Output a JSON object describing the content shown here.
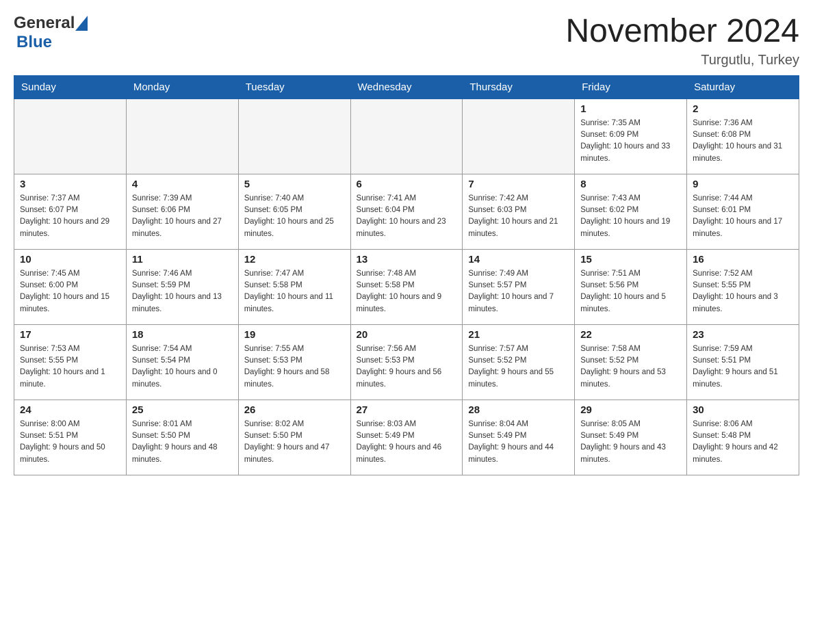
{
  "header": {
    "logo_general": "General",
    "logo_blue": "Blue",
    "month_title": "November 2024",
    "location": "Turgutlu, Turkey"
  },
  "weekdays": [
    "Sunday",
    "Monday",
    "Tuesday",
    "Wednesday",
    "Thursday",
    "Friday",
    "Saturday"
  ],
  "weeks": [
    [
      {
        "day": "",
        "empty": true
      },
      {
        "day": "",
        "empty": true
      },
      {
        "day": "",
        "empty": true
      },
      {
        "day": "",
        "empty": true
      },
      {
        "day": "",
        "empty": true
      },
      {
        "day": "1",
        "sunrise": "Sunrise: 7:35 AM",
        "sunset": "Sunset: 6:09 PM",
        "daylight": "Daylight: 10 hours and 33 minutes."
      },
      {
        "day": "2",
        "sunrise": "Sunrise: 7:36 AM",
        "sunset": "Sunset: 6:08 PM",
        "daylight": "Daylight: 10 hours and 31 minutes."
      }
    ],
    [
      {
        "day": "3",
        "sunrise": "Sunrise: 7:37 AM",
        "sunset": "Sunset: 6:07 PM",
        "daylight": "Daylight: 10 hours and 29 minutes."
      },
      {
        "day": "4",
        "sunrise": "Sunrise: 7:39 AM",
        "sunset": "Sunset: 6:06 PM",
        "daylight": "Daylight: 10 hours and 27 minutes."
      },
      {
        "day": "5",
        "sunrise": "Sunrise: 7:40 AM",
        "sunset": "Sunset: 6:05 PM",
        "daylight": "Daylight: 10 hours and 25 minutes."
      },
      {
        "day": "6",
        "sunrise": "Sunrise: 7:41 AM",
        "sunset": "Sunset: 6:04 PM",
        "daylight": "Daylight: 10 hours and 23 minutes."
      },
      {
        "day": "7",
        "sunrise": "Sunrise: 7:42 AM",
        "sunset": "Sunset: 6:03 PM",
        "daylight": "Daylight: 10 hours and 21 minutes."
      },
      {
        "day": "8",
        "sunrise": "Sunrise: 7:43 AM",
        "sunset": "Sunset: 6:02 PM",
        "daylight": "Daylight: 10 hours and 19 minutes."
      },
      {
        "day": "9",
        "sunrise": "Sunrise: 7:44 AM",
        "sunset": "Sunset: 6:01 PM",
        "daylight": "Daylight: 10 hours and 17 minutes."
      }
    ],
    [
      {
        "day": "10",
        "sunrise": "Sunrise: 7:45 AM",
        "sunset": "Sunset: 6:00 PM",
        "daylight": "Daylight: 10 hours and 15 minutes."
      },
      {
        "day": "11",
        "sunrise": "Sunrise: 7:46 AM",
        "sunset": "Sunset: 5:59 PM",
        "daylight": "Daylight: 10 hours and 13 minutes."
      },
      {
        "day": "12",
        "sunrise": "Sunrise: 7:47 AM",
        "sunset": "Sunset: 5:58 PM",
        "daylight": "Daylight: 10 hours and 11 minutes."
      },
      {
        "day": "13",
        "sunrise": "Sunrise: 7:48 AM",
        "sunset": "Sunset: 5:58 PM",
        "daylight": "Daylight: 10 hours and 9 minutes."
      },
      {
        "day": "14",
        "sunrise": "Sunrise: 7:49 AM",
        "sunset": "Sunset: 5:57 PM",
        "daylight": "Daylight: 10 hours and 7 minutes."
      },
      {
        "day": "15",
        "sunrise": "Sunrise: 7:51 AM",
        "sunset": "Sunset: 5:56 PM",
        "daylight": "Daylight: 10 hours and 5 minutes."
      },
      {
        "day": "16",
        "sunrise": "Sunrise: 7:52 AM",
        "sunset": "Sunset: 5:55 PM",
        "daylight": "Daylight: 10 hours and 3 minutes."
      }
    ],
    [
      {
        "day": "17",
        "sunrise": "Sunrise: 7:53 AM",
        "sunset": "Sunset: 5:55 PM",
        "daylight": "Daylight: 10 hours and 1 minute."
      },
      {
        "day": "18",
        "sunrise": "Sunrise: 7:54 AM",
        "sunset": "Sunset: 5:54 PM",
        "daylight": "Daylight: 10 hours and 0 minutes."
      },
      {
        "day": "19",
        "sunrise": "Sunrise: 7:55 AM",
        "sunset": "Sunset: 5:53 PM",
        "daylight": "Daylight: 9 hours and 58 minutes."
      },
      {
        "day": "20",
        "sunrise": "Sunrise: 7:56 AM",
        "sunset": "Sunset: 5:53 PM",
        "daylight": "Daylight: 9 hours and 56 minutes."
      },
      {
        "day": "21",
        "sunrise": "Sunrise: 7:57 AM",
        "sunset": "Sunset: 5:52 PM",
        "daylight": "Daylight: 9 hours and 55 minutes."
      },
      {
        "day": "22",
        "sunrise": "Sunrise: 7:58 AM",
        "sunset": "Sunset: 5:52 PM",
        "daylight": "Daylight: 9 hours and 53 minutes."
      },
      {
        "day": "23",
        "sunrise": "Sunrise: 7:59 AM",
        "sunset": "Sunset: 5:51 PM",
        "daylight": "Daylight: 9 hours and 51 minutes."
      }
    ],
    [
      {
        "day": "24",
        "sunrise": "Sunrise: 8:00 AM",
        "sunset": "Sunset: 5:51 PM",
        "daylight": "Daylight: 9 hours and 50 minutes."
      },
      {
        "day": "25",
        "sunrise": "Sunrise: 8:01 AM",
        "sunset": "Sunset: 5:50 PM",
        "daylight": "Daylight: 9 hours and 48 minutes."
      },
      {
        "day": "26",
        "sunrise": "Sunrise: 8:02 AM",
        "sunset": "Sunset: 5:50 PM",
        "daylight": "Daylight: 9 hours and 47 minutes."
      },
      {
        "day": "27",
        "sunrise": "Sunrise: 8:03 AM",
        "sunset": "Sunset: 5:49 PM",
        "daylight": "Daylight: 9 hours and 46 minutes."
      },
      {
        "day": "28",
        "sunrise": "Sunrise: 8:04 AM",
        "sunset": "Sunset: 5:49 PM",
        "daylight": "Daylight: 9 hours and 44 minutes."
      },
      {
        "day": "29",
        "sunrise": "Sunrise: 8:05 AM",
        "sunset": "Sunset: 5:49 PM",
        "daylight": "Daylight: 9 hours and 43 minutes."
      },
      {
        "day": "30",
        "sunrise": "Sunrise: 8:06 AM",
        "sunset": "Sunset: 5:48 PM",
        "daylight": "Daylight: 9 hours and 42 minutes."
      }
    ]
  ]
}
